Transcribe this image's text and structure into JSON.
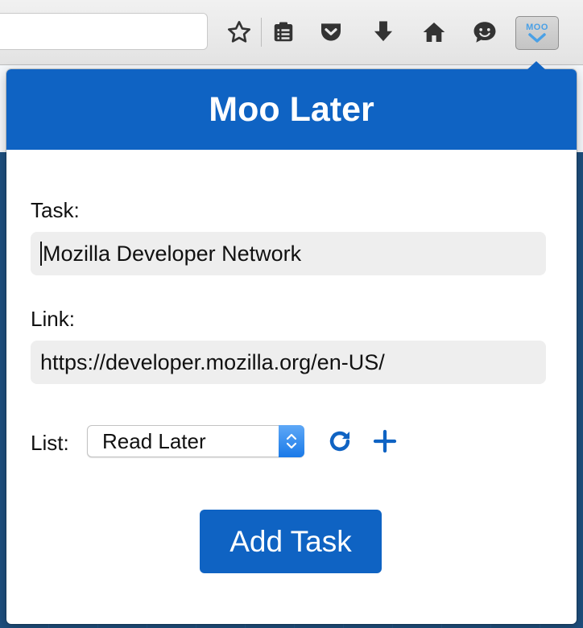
{
  "toolbar": {
    "url_value": "",
    "icons": [
      "star-icon",
      "reading-list-icon",
      "pocket-icon",
      "download-icon",
      "home-icon",
      "hello-icon"
    ],
    "extension_label": "MOO"
  },
  "popup": {
    "title": "Moo Later",
    "task_label": "Task:",
    "task_value": "Mozilla Developer Network",
    "link_label": "Link:",
    "link_value": "https://developer.mozilla.org/en-US/",
    "list_label": "List:",
    "list_selected": "Read Later",
    "add_button_label": "Add Task"
  },
  "colors": {
    "accent": "#0f63c3",
    "field_bg": "#eeeeee",
    "select_arrow": "#1a7ae8"
  }
}
